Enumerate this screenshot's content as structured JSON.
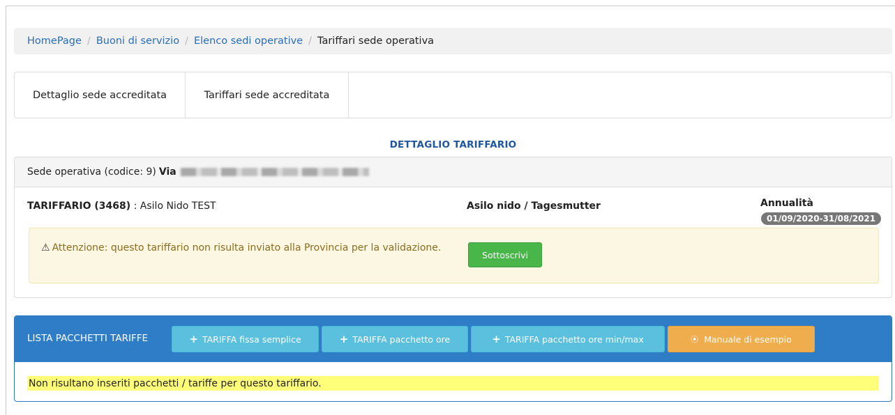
{
  "breadcrumb": {
    "items": [
      "HomePage",
      "Buoni di servizio",
      "Elenco sedi operative"
    ],
    "separator": "/",
    "current": "Tariffari sede operativa"
  },
  "tabs": [
    {
      "label": "Dettaglio sede accreditata"
    },
    {
      "label": "Tariffari sede accreditata"
    }
  ],
  "section_title": "DETTAGLIO TARIFFARIO",
  "panel": {
    "head_prefix": "Sede operativa (codice: 9)",
    "head_via": "Via",
    "tariff_code": "TARIFFARIO (3468)",
    "tariff_name": " : Asilo Nido TEST",
    "service_type": "Asilo nido / Tagesmutter",
    "annual_label": "Annualità",
    "annual_badge": "01/09/2020-31/08/2021",
    "alert_icon": "⚠",
    "alert_text": "Attenzione: questo tariffario non risulta inviato alla Provincia per la validazione.",
    "sign_button": "Sottoscrivi"
  },
  "list": {
    "title": "LISTA PACCHETTI TARIFFE",
    "buttons": {
      "fixed": "TARIFFA fissa semplice",
      "hours": "TARIFFA pacchetto ore",
      "minmax": "TARIFFA pacchetto ore min/max",
      "manual": "Manuale di esempio"
    },
    "empty_message": "Non risultano inseriti pacchetti / tariffe per questo tariffario."
  },
  "colors": {
    "link": "#2a6db5",
    "title_blue": "#1f56a0",
    "success": "#48b648",
    "info": "#5bc0de",
    "warning": "#f0ad4e",
    "list_header": "#2f7cc7",
    "highlight": "#ffff7a"
  }
}
